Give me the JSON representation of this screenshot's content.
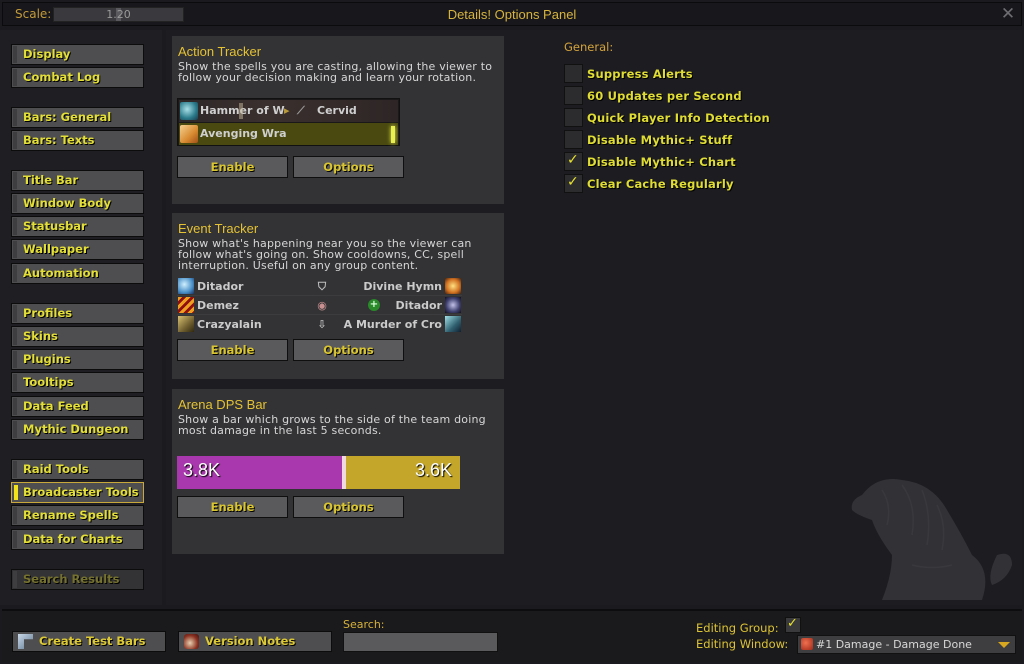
{
  "titlebar": {
    "scale_label": "Scale:",
    "scale_value": "1.20",
    "title": "Details! Options Panel",
    "close_glyph": "✕"
  },
  "sidebar": {
    "groups": [
      [
        "Display",
        "Combat Log"
      ],
      [
        "Bars: General",
        "Bars: Texts"
      ],
      [
        "Title Bar",
        "Window Body",
        "Statusbar",
        "Wallpaper",
        "Automation"
      ],
      [
        "Profiles",
        "Skins",
        "Plugins",
        "Tooltips",
        "Data Feed",
        "Mythic Dungeon"
      ],
      [
        "Raid Tools",
        "Broadcaster Tools",
        "Rename Spells",
        "Data for Charts"
      ],
      [
        "Search Results"
      ]
    ],
    "items": {
      "display": "Display",
      "combat_log": "Combat Log",
      "bars_general": "Bars: General",
      "bars_texts": "Bars: Texts",
      "title_bar": "Title Bar",
      "window_body": "Window Body",
      "statusbar": "Statusbar",
      "wallpaper": "Wallpaper",
      "automation": "Automation",
      "profiles": "Profiles",
      "skins": "Skins",
      "plugins": "Plugins",
      "tooltips": "Tooltips",
      "data_feed": "Data Feed",
      "mythic_dungeon": "Mythic Dungeon",
      "raid_tools": "Raid Tools",
      "broadcaster_tools": "Broadcaster Tools",
      "rename_spells": "Rename Spells",
      "data_for_charts": "Data for Charts",
      "search_results": "Search Results"
    },
    "active": "Broadcaster Tools"
  },
  "cards": {
    "action_tracker": {
      "title": "Action Tracker",
      "description": "Show the spells you are casting, allowing the viewer to follow your decision making and learn your rotation.",
      "preview": {
        "row1_spell": "Hammer of W",
        "row1_arrow": "▸",
        "row1_target": "Cervid Grazer",
        "row2_spell": "Avenging Wra"
      },
      "enable_label": "Enable",
      "options_label": "Options"
    },
    "event_tracker": {
      "title": "Event Tracker",
      "description": "Show what's happening near you so the viewer can follow what's going on. Show cooldowns, CC, spell interruption. Useful on any group content.",
      "rows": [
        {
          "left": "Ditador",
          "mid_icon": "shield-icon",
          "mid_glyph": "⛉",
          "right": "Divine Hymn"
        },
        {
          "left": "Demez",
          "mid_icon": "eye-icon",
          "mid_glyph": "◉",
          "right": "Ditador"
        },
        {
          "left": "Crazyalain",
          "mid_icon": "dagger-icon",
          "mid_glyph": "🗡",
          "right": "A Murder of Cro"
        }
      ],
      "enable_label": "Enable",
      "options_label": "Options"
    },
    "arena_dps_bar": {
      "title": "Arena DPS Bar",
      "description": "Show a bar which grows to the side of the team doing most damage in the last 5 seconds.",
      "left_value": "3.8K",
      "right_value": "3.6K",
      "left_fraction": 0.59,
      "left_color": "#a938ae",
      "right_color": "#c4a72a",
      "enable_label": "Enable",
      "options_label": "Options"
    }
  },
  "general": {
    "title": "General:",
    "options": [
      {
        "label": "Suppress Alerts",
        "checked": false
      },
      {
        "label": "60 Updates per Second",
        "checked": false
      },
      {
        "label": "Quick Player Info Detection",
        "checked": false
      },
      {
        "label": "Disable Mythic+ Stuff",
        "checked": false
      },
      {
        "label": "Disable Mythic+ Chart",
        "checked": true
      },
      {
        "label": "Clear Cache Regularly",
        "checked": true
      }
    ]
  },
  "footer": {
    "create_test_bars": "Create Test Bars",
    "version_notes": "Version Notes",
    "search_label": "Search:",
    "search_value": "",
    "editing_group_label": "Editing Group:",
    "editing_group_checked": true,
    "editing_window_label": "Editing Window:",
    "editing_window_value": "#1 Damage - Damage Done"
  },
  "colors": {
    "accent_yellow": "#e6e23c",
    "title_gold": "#d7b43e",
    "active_marker": "#f2e21c"
  }
}
